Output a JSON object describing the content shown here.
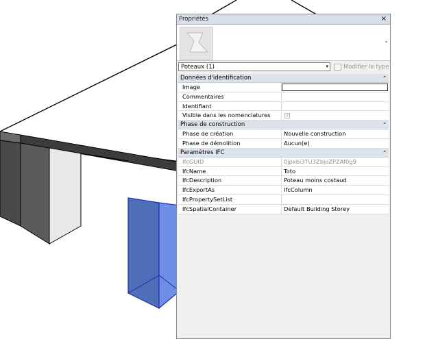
{
  "properties_panel": {
    "title": "Propriétés",
    "close_glyph": "×",
    "preview_icon": "revit-family-icon",
    "type_selector": {
      "value": "Poteaux (1)",
      "arrow": "▾"
    },
    "edit_type_label": "Modifier le type",
    "groups": [
      {
        "label": "Données d'identification",
        "collapse_glyph": "⌃",
        "rows": [
          {
            "name": "Image",
            "value": ""
          },
          {
            "name": "Commentaires",
            "value": ""
          },
          {
            "name": "Identifiant",
            "value": ""
          },
          {
            "name": "Visible dans les nomenclatures",
            "value": "",
            "checked": true
          }
        ]
      },
      {
        "label": "Phase de construction",
        "collapse_glyph": "⌃",
        "rows": [
          {
            "name": "Phase de création",
            "value": "Nouvelle construction"
          },
          {
            "name": "Phase de démolition",
            "value": "Aucun(e)"
          }
        ]
      },
      {
        "label": "Paramètres IFC",
        "collapse_glyph": "⌃",
        "rows": [
          {
            "name": "IfcGUID",
            "value": "0jpxbi3TU3ZbjoZPZAf0g9",
            "readonly": true
          },
          {
            "name": "IfcName",
            "value": "Toto"
          },
          {
            "name": "IfcDescription",
            "value": "Poteau moins costaud"
          },
          {
            "name": "IfcExportAs",
            "value": "IfcColumn"
          },
          {
            "name": "IfcPropertySetList",
            "value": ""
          },
          {
            "name": "IfcSpatialContainer",
            "value": "Default Building Storey"
          }
        ]
      }
    ]
  },
  "colors": {
    "selected_column": "#4a6fd6",
    "slab_top": "#ffffff",
    "dark_face": "#5a5a5a"
  }
}
